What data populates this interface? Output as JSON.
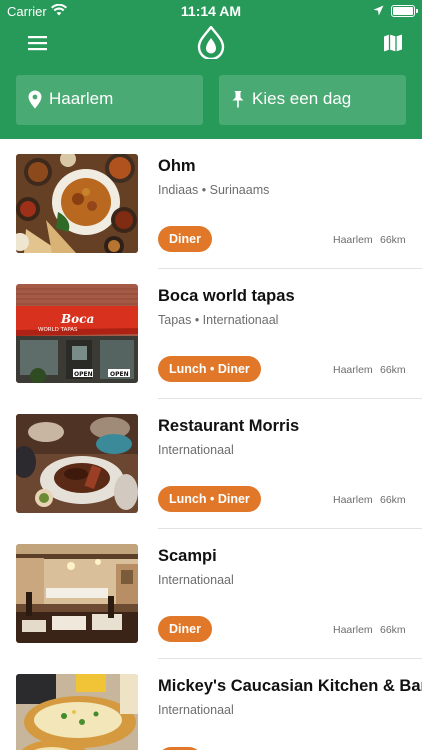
{
  "status_bar": {
    "carrier": "Carrier",
    "time": "11:14 AM"
  },
  "header": {
    "background_color": "#279a59",
    "location_field": {
      "value": "Haarlem",
      "icon": "location-pin-icon"
    },
    "day_field": {
      "value": "Kies een dag",
      "icon": "pushpin-icon"
    },
    "menu_icon": "hamburger-menu-icon",
    "map_icon": "map-icon",
    "logo": "app-logo-drop"
  },
  "restaurants": [
    {
      "name": "Ohm",
      "cuisine": "Indiaas • Surinaams",
      "badge": "Diner",
      "city": "Haarlem",
      "distance": "66km"
    },
    {
      "name": "Boca world tapas",
      "cuisine": "Tapas • Internationaal",
      "badge": "Lunch • Diner",
      "city": "Haarlem",
      "distance": "66km",
      "photo_sign_text": "Boca",
      "photo_sign_subtext": "WORLD TAPAS",
      "photo_door_text": "OPEN"
    },
    {
      "name": "Restaurant Morris",
      "cuisine": "Internationaal",
      "badge": "Lunch • Diner",
      "city": "Haarlem",
      "distance": "66km"
    },
    {
      "name": "Scampi",
      "cuisine": "Internationaal",
      "badge": "Diner",
      "city": "Haarlem",
      "distance": "66km"
    },
    {
      "name": "Mickey's Caucasian Kitchen & Bar",
      "cuisine": "Internationaal",
      "badge": "",
      "city": "",
      "distance": ""
    }
  ],
  "colors": {
    "accent_badge": "#e07729",
    "header_green": "#279a59"
  }
}
